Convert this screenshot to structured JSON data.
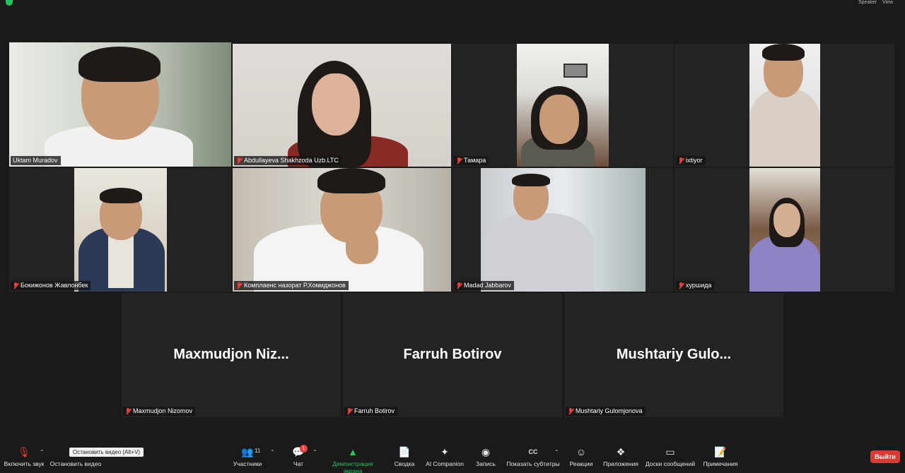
{
  "top_bar": {
    "speaker_view_label": "Speaker",
    "gallery_view_label": "View"
  },
  "participants": [
    {
      "name": "Uktam Muradov"
    },
    {
      "name": "Abdullayeva Shakhzoda Uzb.LTC"
    },
    {
      "name": "Тамара"
    },
    {
      "name": "ixtiyor"
    },
    {
      "name": "Бокижонов Жавлонбек"
    },
    {
      "name": "Комплаенс назорат Р.Хомиджонов"
    },
    {
      "name": "Madad Jabbarov"
    },
    {
      "name": "хуршида"
    },
    {
      "name": "Maxmudjon Nizomov",
      "display": "Maxmudjon  Niz..."
    },
    {
      "name": "Farruh Botirov",
      "display": "Farruh Botirov"
    },
    {
      "name": "Mushtariy Gulomjonova",
      "display": "Mushtariy  Gulo..."
    }
  ],
  "toolbar": {
    "unmute": "Включить звук",
    "stop_video": "Остановить видео",
    "tooltip": "Остановить видео (Alt+V)",
    "participants": "Участники",
    "participants_count": "11",
    "chat": "Чат",
    "chat_badge": "1",
    "share": "Демонстрация экрана",
    "summary": "Сводка",
    "ai": "AI Companion",
    "record": "Запись",
    "captions": "Показать субтитры",
    "reactions": "Реакции",
    "apps": "Приложения",
    "whiteboards": "Доски сообщений",
    "notes": "Примечания",
    "leave": "Выйти"
  },
  "colors": {
    "active_speaker_border": "#d7e34a",
    "share_green": "#27c25a",
    "leave_red": "#d93a32"
  }
}
